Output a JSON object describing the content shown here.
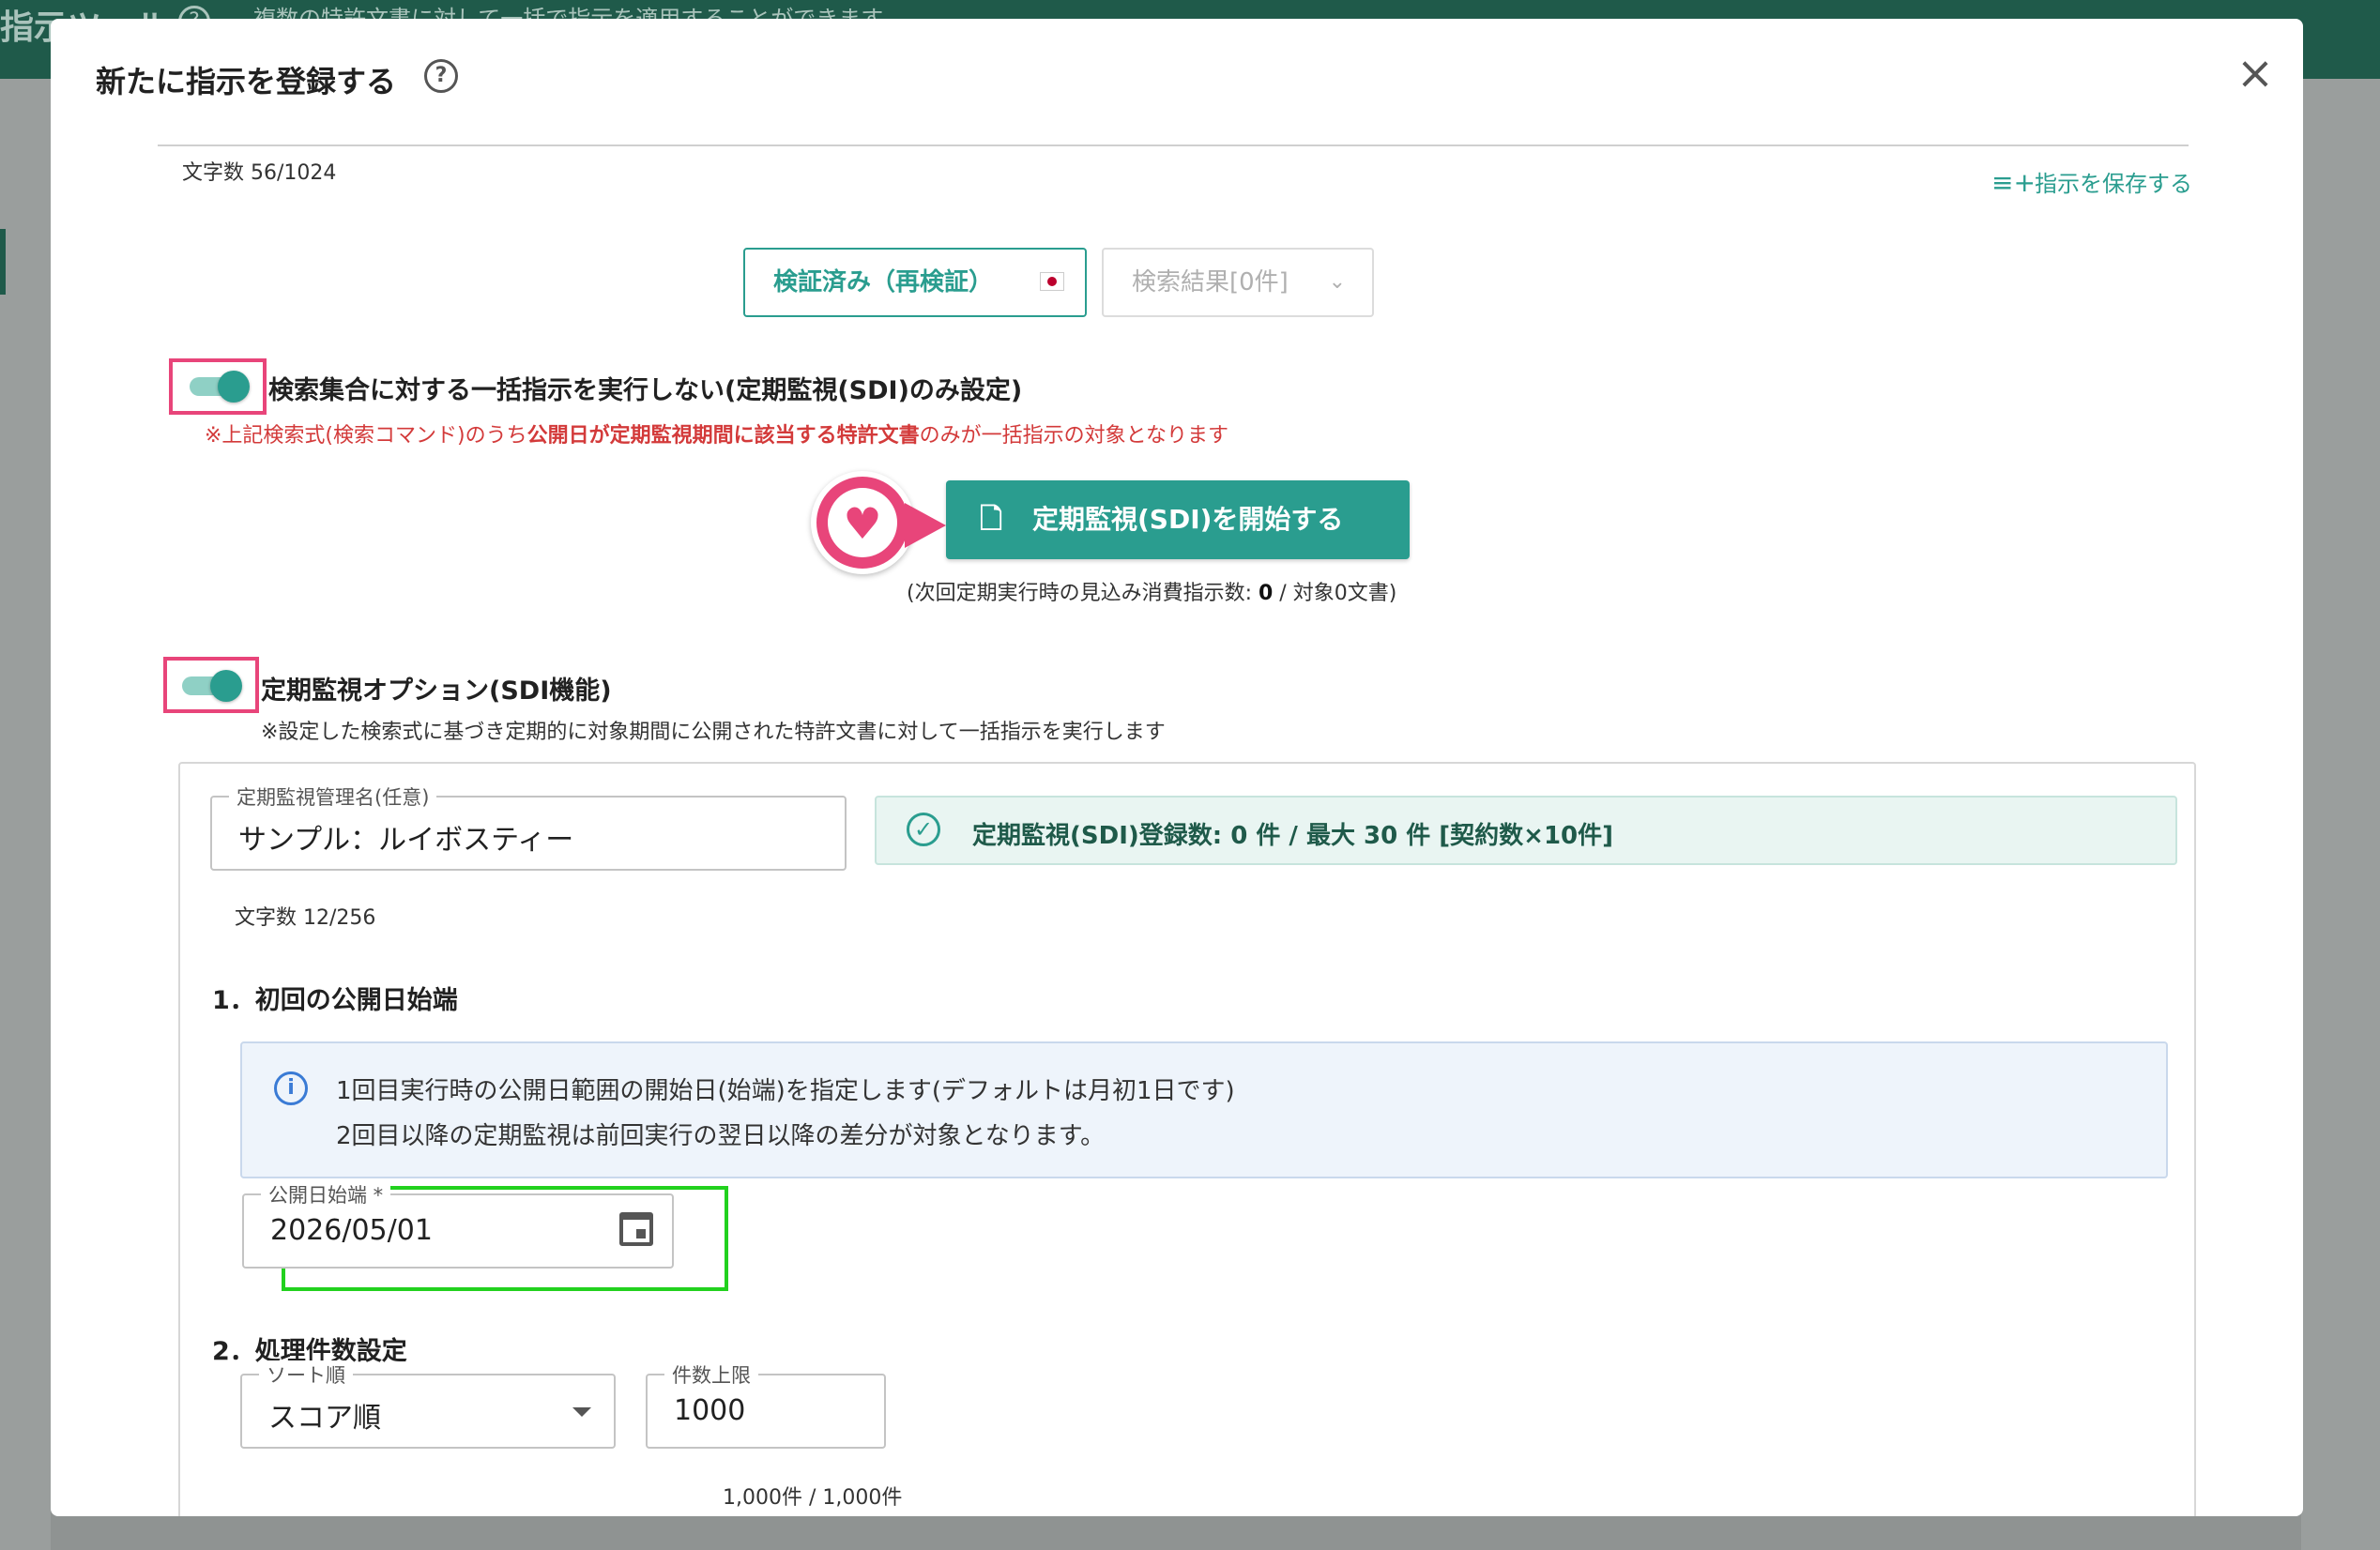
{
  "background": {
    "title": "指示ツール",
    "subtitle": "複数の特許文書に対して一括で指示を適用することができます"
  },
  "modal": {
    "title": "新たに指示を登録する",
    "close_label": "×"
  },
  "instruction": {
    "char_count": "文字数 56/1024",
    "save_label": "指示を保存する"
  },
  "buttons": {
    "verified_label": "検証済み（再検証）",
    "result_label": "検索結果[0件]",
    "start_label": "定期監視(SDI)を開始する"
  },
  "bulk_toggle": {
    "label": "検索集合に対する一括指示を実行しない(定期監視(SDI)のみ設定)",
    "on": true,
    "note_prefix": "※上記検索式(検索コマンド)のうち",
    "note_bold": "公開日が定期監視期間に該当する特許文書",
    "note_suffix": "のみが一括指示の対象となります"
  },
  "estimate": {
    "prefix": "(次回定期実行時の見込み消費指示数: ",
    "value": "0",
    "suffix": " / 対象0文書)"
  },
  "sdi_toggle": {
    "label": "定期監視オプション(SDI機能)",
    "on": true,
    "note": "※設定した検索式に基づき定期的に対象期間に公開された特許文書に対して一括指示を実行します"
  },
  "sdi_form": {
    "name_legend": "定期監視管理名(任意)",
    "name_value": "サンプル：ルイボスティー",
    "name_char_count": "文字数 12/256",
    "count_banner": "定期監視(SDI)登録数: 0 件 / 最大 30 件 [契約数×10件]",
    "section1_title": "1．初回の公開日始端",
    "info_line1": "1回目実行時の公開日範囲の開始日(始端)を指定します(デフォルトは月初1日です)",
    "info_line2": "2回目以降の定期監視は前回実行の翌日以降の差分が対象となります。",
    "date_legend": "公開日始端 *",
    "date_value": "2026/05/01",
    "section2_title": "2．処理件数設定",
    "sort_legend": "ソート順",
    "sort_value": "スコア順",
    "limit_legend": "件数上限",
    "limit_value": "1000",
    "limit_note": "1,000件 / 1,000件"
  },
  "colors": {
    "primary": "#2a9d8f",
    "highlight_pink": "#e8457a",
    "highlight_green": "#22d11e",
    "note_red": "#d33a3a"
  },
  "icons": {
    "help": "help-circle-icon",
    "close": "close-icon",
    "save": "playlist-add-icon",
    "start": "file-plus-icon",
    "heart": "heart-icon",
    "check": "check-circle-icon",
    "info": "info-icon",
    "calendar": "calendar-icon"
  }
}
